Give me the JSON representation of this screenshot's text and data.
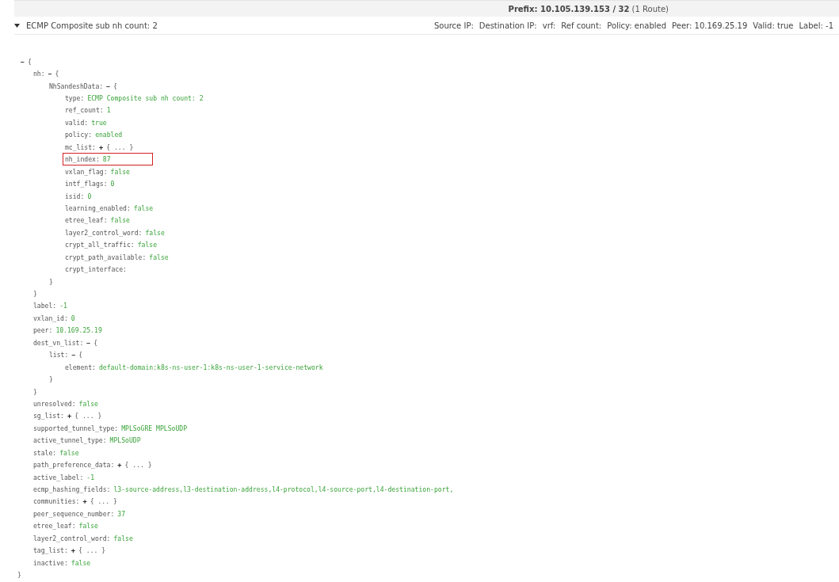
{
  "prefix_bar": {
    "text": "**Prefix: 10.105.139.153 / 32** (1 Route)"
  },
  "route_row": {
    "expanded": true,
    "title": "ECMP Composite sub nh count: 2",
    "fields": [
      "Source IP:",
      "Destination IP:",
      "vrf:",
      "Ref count:",
      "Policy: enabled",
      "Peer: 10.169.25.19",
      "Valid: true",
      "Label: -1"
    ]
  },
  "tree": {
    "kind": "object",
    "toggle": "−",
    "expanded": true,
    "open": "{",
    "close": "}",
    "children": [
      {
        "kind": "object",
        "key": "nh:",
        "toggle": "−",
        "expanded": true,
        "open": "{",
        "close": "}",
        "children": [
          {
            "kind": "object",
            "key": "NhSandeshData:",
            "toggle": "−",
            "expanded": true,
            "open": "{",
            "close": "}",
            "children": [
              {
                "kind": "leaf",
                "key": "type:",
                "value": "ECMP Composite sub nh count: 2",
                "highlighted": false
              },
              {
                "kind": "leaf",
                "key": "ref_count:",
                "value": "1",
                "highlighted": false
              },
              {
                "kind": "leaf",
                "key": "valid:",
                "value": "true",
                "highlighted": false
              },
              {
                "kind": "leaf",
                "key": "policy:",
                "value": "enabled",
                "highlighted": false
              },
              {
                "kind": "object",
                "key": "mc_list:",
                "toggle": "+",
                "expanded": false,
                "summary": "{ ... }"
              },
              {
                "kind": "leaf",
                "key": "nh_index:",
                "value": "87",
                "highlighted": true
              },
              {
                "kind": "leaf",
                "key": "vxlan_flag:",
                "value": "false",
                "highlighted": false
              },
              {
                "kind": "leaf",
                "key": "intf_flags:",
                "value": "0",
                "highlighted": false
              },
              {
                "kind": "leaf",
                "key": "isid:",
                "value": "0",
                "highlighted": false
              },
              {
                "kind": "leaf",
                "key": "learning_enabled:",
                "value": "false",
                "highlighted": false
              },
              {
                "kind": "leaf",
                "key": "etree_leaf:",
                "value": "false",
                "highlighted": false
              },
              {
                "kind": "leaf",
                "key": "layer2_control_word:",
                "value": "false",
                "highlighted": false
              },
              {
                "kind": "leaf",
                "key": "crypt_all_traffic:",
                "value": "false",
                "highlighted": false
              },
              {
                "kind": "leaf",
                "key": "crypt_path_available:",
                "value": "false",
                "highlighted": false
              },
              {
                "kind": "leaf",
                "key": "crypt_interface:",
                "highlighted": false
              }
            ]
          }
        ]
      },
      {
        "kind": "leaf",
        "key": "label:",
        "value": "-1",
        "highlighted": false
      },
      {
        "kind": "leaf",
        "key": "vxlan_id:",
        "value": "0",
        "highlighted": false
      },
      {
        "kind": "leaf",
        "key": "peer:",
        "value": "10.169.25.19",
        "highlighted": false
      },
      {
        "kind": "object",
        "key": "dest_vn_list:",
        "toggle": "−",
        "expanded": true,
        "open": "{",
        "close": "}",
        "children": [
          {
            "kind": "object",
            "key": "list:",
            "toggle": "−",
            "expanded": true,
            "open": "{",
            "close": "}",
            "children": [
              {
                "kind": "leaf",
                "key": "element:",
                "value": "default-domain:k8s-ns-user-1:k8s-ns-user-1-service-network",
                "highlighted": false
              }
            ]
          }
        ]
      },
      {
        "kind": "leaf",
        "key": "unresolved:",
        "value": "false",
        "highlighted": false
      },
      {
        "kind": "object",
        "key": "sg_list:",
        "toggle": "+",
        "expanded": false,
        "summary": "{ ... }"
      },
      {
        "kind": "leaf",
        "key": "supported_tunnel_type:",
        "value": "MPLSoGRE MPLSoUDP",
        "highlighted": false
      },
      {
        "kind": "leaf",
        "key": "active_tunnel_type:",
        "value": "MPLSoUDP",
        "highlighted": false
      },
      {
        "kind": "leaf",
        "key": "stale:",
        "value": "false",
        "highlighted": false
      },
      {
        "kind": "object",
        "key": "path_preference_data:",
        "toggle": "+",
        "expanded": false,
        "summary": "{ ... }"
      },
      {
        "kind": "leaf",
        "key": "active_label:",
        "value": "-1",
        "highlighted": false
      },
      {
        "kind": "leaf",
        "key": "ecmp_hashing_fields:",
        "value": "l3-source-address,l3-destination-address,l4-protocol,l4-source-port,l4-destination-port,",
        "highlighted": false
      },
      {
        "kind": "object",
        "key": "communities:",
        "toggle": "+",
        "expanded": false,
        "summary": "{ ... }"
      },
      {
        "kind": "leaf",
        "key": "peer_sequence_number:",
        "value": "37",
        "highlighted": false
      },
      {
        "kind": "leaf",
        "key": "etree_leaf:",
        "value": "false",
        "highlighted": false
      },
      {
        "kind": "leaf",
        "key": "layer2_control_word:",
        "value": "false",
        "highlighted": false
      },
      {
        "kind": "object",
        "key": "tag_list:",
        "toggle": "+",
        "expanded": false,
        "summary": "{ ... }"
      },
      {
        "kind": "leaf",
        "key": "inactive:",
        "value": "false",
        "highlighted": false
      }
    ]
  }
}
